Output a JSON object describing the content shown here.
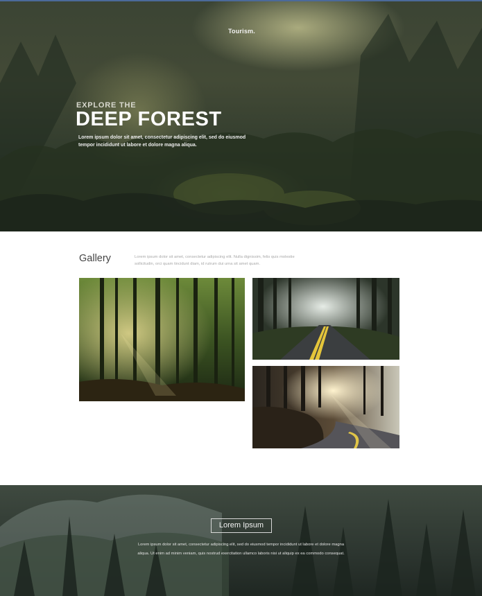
{
  "hero": {
    "brand": "Tourism",
    "brand_dot": ".",
    "eyebrow": "EXPLORE THE",
    "headline": "DEEP FOREST",
    "text": "Lorem ipsum dolor sit amet, consectetur adipiscing elit, sed do eiusmod tempor incididunt ut labore et dolore magna aliqua."
  },
  "gallery": {
    "title": "Gallery",
    "description": "Lorem ipsum dolor sit amet, consectetur adipiscing elit. Nulla dignissim, felis quis molestie sollicitudin, orci quam tincidunt diam, id rutrum dui urna sit amet quam."
  },
  "footer": {
    "button_label": "Lorem Ipsum",
    "text": "Lorem ipsum dolor sit amet, consectetur adipiscing elit, sed do eiusmod tempor incididunt ut labore et dolore magna aliqua. Ut enim ad minim veniam, quis nostrud exercitation ullamco laboris nisi ut aliquip ex ea commodo consequat."
  },
  "colors": {
    "footer_button_border": "#d9d9d9",
    "headline": "#ffffff",
    "gallery_title": "#444444",
    "body_muted": "#a8a8a8"
  }
}
